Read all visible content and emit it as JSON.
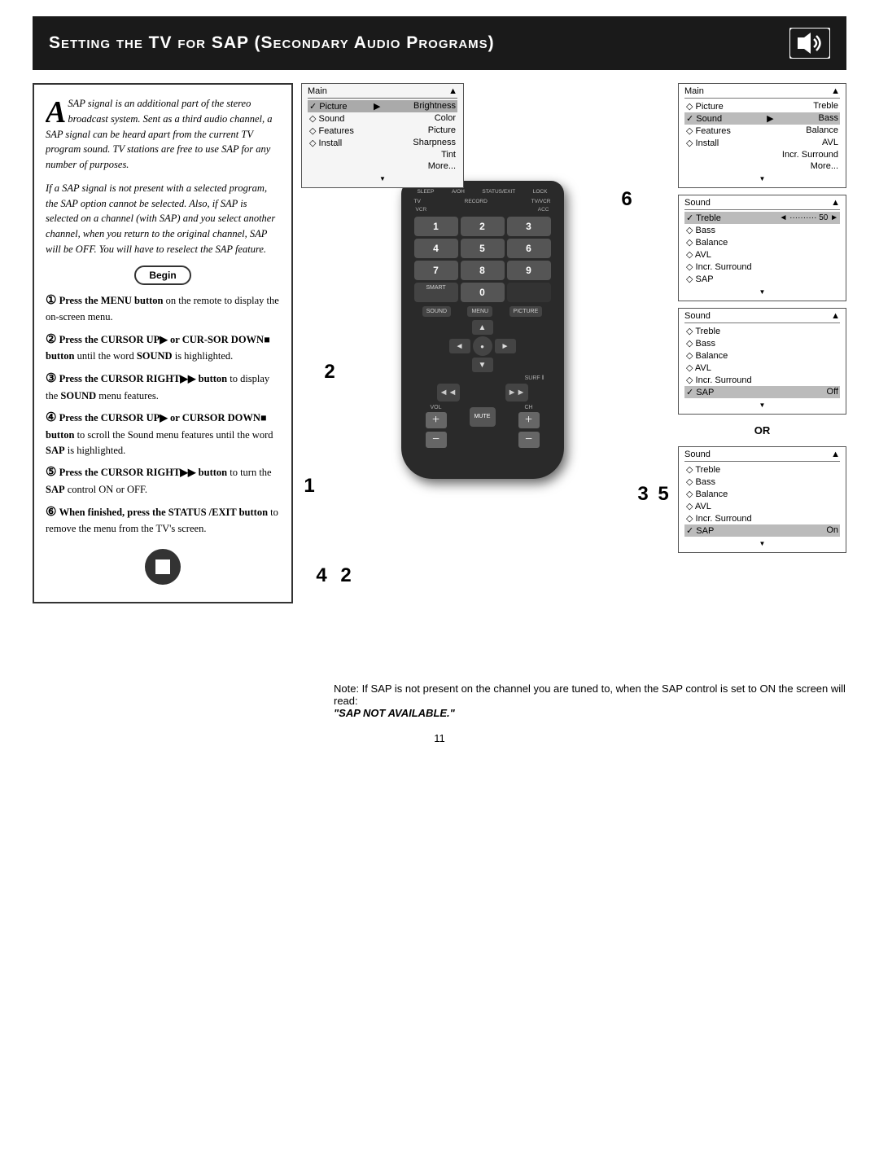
{
  "header": {
    "title": "Setting the TV for SAP (Secondary Audio Programs)"
  },
  "intro": {
    "paragraph1": "SAP signal is an additional part of the stereo broadcast system.  Sent as a third audio channel, a SAP signal can be heard apart from the current TV program sound.  TV stations are free to use SAP for any number of purposes.",
    "paragraph2": "If a SAP signal is not present with a selected program, the SAP option cannot be selected.  Also, if SAP is selected on a channel (with SAP) and you select another channel, when you return to the original channel, SAP will be OFF.  You will have to reselect the SAP feature."
  },
  "begin_label": "Begin",
  "steps": [
    {
      "num": "1",
      "text": "Press the MENU button on the remote to display the on-screen menu."
    },
    {
      "num": "2",
      "text": "Press the CURSOR UP ▶ or CURSOR DOWN ■ button until the word SOUND is highlighted."
    },
    {
      "num": "3",
      "text": "Press the CURSOR RIGHT ▶▶ button to display the SOUND menu features."
    },
    {
      "num": "4",
      "text": "Press the CURSOR UP ▶ or CURSOR DOWN ■ button to scroll the Sound menu features until the word SAP is highlighted."
    },
    {
      "num": "5",
      "text": "Press the CURSOR RIGHT ▶▶ button to turn the SAP control ON or OFF."
    },
    {
      "num": "6",
      "text": "When finished, press the STATUS/EXIT button to remove the menu from the TV's screen."
    }
  ],
  "menus": {
    "main_menu": {
      "title": "Main",
      "items": [
        {
          "label": "✓ Picture",
          "right": "▶",
          "sub": "Brightness"
        },
        {
          "label": "◇ Sound",
          "right": "",
          "sub": "Color"
        },
        {
          "label": "◇ Features",
          "right": "",
          "sub": "Picture"
        },
        {
          "label": "◇ Install",
          "right": "",
          "sub": "Sharpness"
        },
        {
          "label": "",
          "right": "",
          "sub": "Tint"
        },
        {
          "label": "",
          "right": "",
          "sub": "More..."
        }
      ]
    },
    "main_sound_menu": {
      "title": "Main",
      "items": [
        {
          "label": "◇ Picture",
          "right": "Treble"
        },
        {
          "label": "✓ Sound",
          "right": "▶",
          "arrow": true
        },
        {
          "label": "◇ Features",
          "right": "Balance"
        },
        {
          "label": "◇ Install",
          "right": "AVL"
        },
        {
          "label": "",
          "right": "Incr. Surround"
        },
        {
          "label": "",
          "right": "More..."
        }
      ]
    },
    "sound_menu_treble": {
      "title": "Sound",
      "items": [
        {
          "label": "✓ Treble",
          "right": "◄ ·········· 50 ►"
        },
        {
          "label": "◇ Bass"
        },
        {
          "label": "◇ Balance"
        },
        {
          "label": "◇ AVL"
        },
        {
          "label": "◇ Incr. Surround"
        },
        {
          "label": "◇ SAP"
        }
      ]
    },
    "sound_menu_sap_off": {
      "title": "Sound",
      "items": [
        {
          "label": "◇ Treble"
        },
        {
          "label": "◇ Bass"
        },
        {
          "label": "◇ Balance"
        },
        {
          "label": "◇ AVL"
        },
        {
          "label": "◇ Incr. Surround"
        },
        {
          "label": "✓ SAP",
          "right": "Off"
        }
      ]
    },
    "sound_menu_sap_on": {
      "title": "Sound",
      "items": [
        {
          "label": "◇ Treble"
        },
        {
          "label": "◇ Bass"
        },
        {
          "label": "◇ Balance"
        },
        {
          "label": "◇ AVL"
        },
        {
          "label": "◇ Incr. Surround"
        },
        {
          "label": "✓ SAP",
          "right": "On"
        }
      ]
    }
  },
  "or_label": "OR",
  "note": {
    "text": "Note: If SAP is not present on the channel you are tuned to, when the SAP control is set to ON the screen will read:",
    "sap_not_available": "\"SAP NOT AVAILABLE.\""
  },
  "page_number": "11",
  "remote": {
    "buttons": {
      "sleep": "SLEEP",
      "aoh": "A/OH",
      "status": "STATUS/EXIT",
      "lock": "LOCK",
      "tv": "TV",
      "record": "RECORD",
      "tv_vcr": "TV/VCR",
      "vcr": "VCR",
      "acc": "ACC",
      "nums": [
        "1",
        "2",
        "3",
        "4",
        "5",
        "6",
        "7",
        "8",
        "9",
        "",
        "0",
        ""
      ],
      "smart": "SMART",
      "sound": "SOUND",
      "menu": "MENU",
      "picture": "PICTURE",
      "surf": "SURF",
      "vol": "VOL",
      "ch": "CH",
      "mute": "MUTE"
    }
  }
}
